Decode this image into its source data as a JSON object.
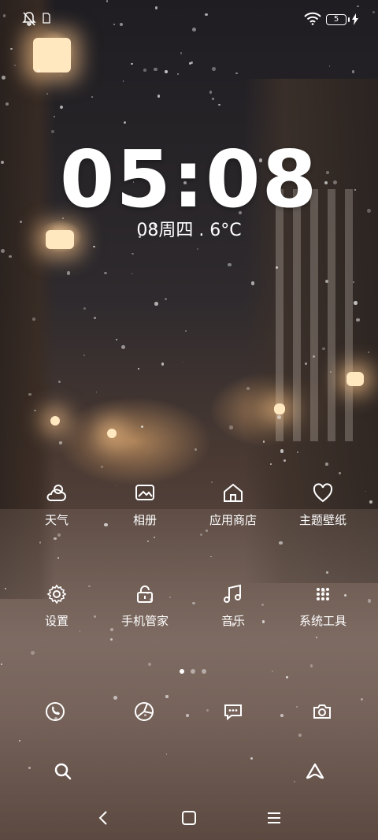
{
  "status_bar": {
    "battery": "5",
    "icons": [
      "bell-off-icon",
      "sim-card-icon",
      "wifi-icon",
      "battery-icon",
      "charging-bolt-icon"
    ]
  },
  "lock": {
    "time": "05:08",
    "date_weather": "08周四 . 6°C"
  },
  "apps": [
    {
      "label": "天气",
      "icon": "weather-icon"
    },
    {
      "label": "相册",
      "icon": "gallery-icon"
    },
    {
      "label": "应用商店",
      "icon": "app-store-icon"
    },
    {
      "label": "主题壁纸",
      "icon": "theme-heart-icon"
    },
    {
      "label": "设置",
      "icon": "settings-gear-icon"
    },
    {
      "label": "手机管家",
      "icon": "security-lock-icon"
    },
    {
      "label": "音乐",
      "icon": "music-note-icon"
    },
    {
      "label": "系统工具",
      "icon": "system-tools-icon"
    }
  ],
  "pager": {
    "count": 3,
    "active": 1
  },
  "dock": [
    {
      "icon": "phone-icon"
    },
    {
      "icon": "browser-icon"
    },
    {
      "icon": "messages-icon"
    },
    {
      "icon": "camera-icon"
    }
  ],
  "bottom": [
    {
      "icon": "search-icon"
    },
    {
      "icon": "assistant-icon"
    }
  ],
  "navbar": [
    {
      "icon": "back-icon"
    },
    {
      "icon": "home-icon"
    },
    {
      "icon": "recents-menu-icon"
    }
  ],
  "colors": {
    "text": "#ffffff",
    "dot_inactive": "rgba(255,255,255,0.45)"
  }
}
